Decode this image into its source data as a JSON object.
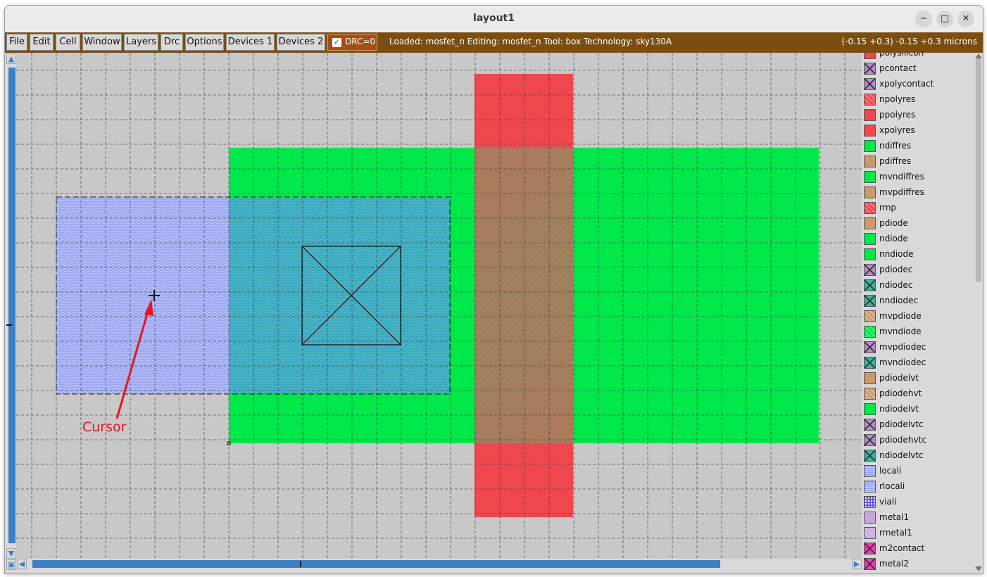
{
  "window": {
    "title": "layout1",
    "minimize_icon": "−",
    "maximize_icon": "□",
    "close_icon": "✕"
  },
  "menu": [
    "File",
    "Edit",
    "Cell",
    "Window",
    "Layers",
    "Drc",
    "Options",
    "Devices 1",
    "Devices 2"
  ],
  "drc": {
    "label": "DRC=0",
    "checked": true
  },
  "status": "Loaded: mosfet_n Editing: mosfet_n Tool: box  Technology: sky130A",
  "coords": "(-0.15 +0.3) -0.15 +0.3 microns",
  "annotation": {
    "label": "Cursor",
    "color": "#e8141e"
  },
  "canvas_colors": {
    "background": "#c8c8c8",
    "diffusion": "#00e84a",
    "poly": "#f0474f",
    "locali": "#9aa6f4",
    "grid": "#3a3a3a"
  },
  "layers": [
    {
      "name": "polysilicon",
      "color": "#f0474f",
      "pattern": "solid"
    },
    {
      "name": "pcontact",
      "color": "#b48ec8",
      "pattern": "x"
    },
    {
      "name": "xpolycontact",
      "color": "#b48ec8",
      "pattern": "x"
    },
    {
      "name": "npolyres",
      "color": "#f0474f",
      "pattern": "hatch"
    },
    {
      "name": "ppolyres",
      "color": "#f0474f",
      "pattern": "solid"
    },
    {
      "name": "xpolyres",
      "color": "#f0474f",
      "pattern": "solid"
    },
    {
      "name": "ndiffres",
      "color": "#00e84a",
      "pattern": "solid"
    },
    {
      "name": "pdiffres",
      "color": "#c89a6e",
      "pattern": "solid"
    },
    {
      "name": "mvndiffres",
      "color": "#00e84a",
      "pattern": "solid"
    },
    {
      "name": "mvpdiffres",
      "color": "#c89a6e",
      "pattern": "solid"
    },
    {
      "name": "rmp",
      "color": "#f0474f",
      "pattern": "hatch"
    },
    {
      "name": "pdiode",
      "color": "#c89a6e",
      "pattern": "solid"
    },
    {
      "name": "ndiode",
      "color": "#00e84a",
      "pattern": "solid"
    },
    {
      "name": "nndiode",
      "color": "#00e84a",
      "pattern": "solid"
    },
    {
      "name": "pdiodec",
      "color": "#b48ec8",
      "pattern": "x"
    },
    {
      "name": "ndiodec",
      "color": "#3cb4a0",
      "pattern": "x"
    },
    {
      "name": "nndiodec",
      "color": "#3cb4a0",
      "pattern": "x"
    },
    {
      "name": "mvpdiode",
      "color": "#c89a6e",
      "pattern": "hatch"
    },
    {
      "name": "mvndiode",
      "color": "#00e84a",
      "pattern": "hatch"
    },
    {
      "name": "mvpdiodec",
      "color": "#b48ec8",
      "pattern": "x"
    },
    {
      "name": "mvndiodec",
      "color": "#3cb4a0",
      "pattern": "x"
    },
    {
      "name": "pdiodelvt",
      "color": "#c89a6e",
      "pattern": "solid"
    },
    {
      "name": "pdiodehvt",
      "color": "#c89a6e",
      "pattern": "hatch"
    },
    {
      "name": "ndiodelvt",
      "color": "#00e84a",
      "pattern": "solid"
    },
    {
      "name": "pdiodelvtc",
      "color": "#b48ec8",
      "pattern": "x"
    },
    {
      "name": "pdiodehvtc",
      "color": "#b48ec8",
      "pattern": "x"
    },
    {
      "name": "ndiodelvtc",
      "color": "#3cb4a0",
      "pattern": "x"
    },
    {
      "name": "locali",
      "color": "#9aa6f4",
      "pattern": "wave"
    },
    {
      "name": "rlocali",
      "color": "#9aa6f4",
      "pattern": "wave"
    },
    {
      "name": "viali",
      "color": "#5a48e8",
      "pattern": "dots"
    },
    {
      "name": "metal1",
      "color": "#c8a8dc",
      "pattern": "solid"
    },
    {
      "name": "rmetal1",
      "color": "#c8a8dc",
      "pattern": "hatch"
    },
    {
      "name": "m2contact",
      "color": "#f03cb4",
      "pattern": "x"
    },
    {
      "name": "metal2",
      "color": "#f03cb4",
      "pattern": "x"
    }
  ]
}
